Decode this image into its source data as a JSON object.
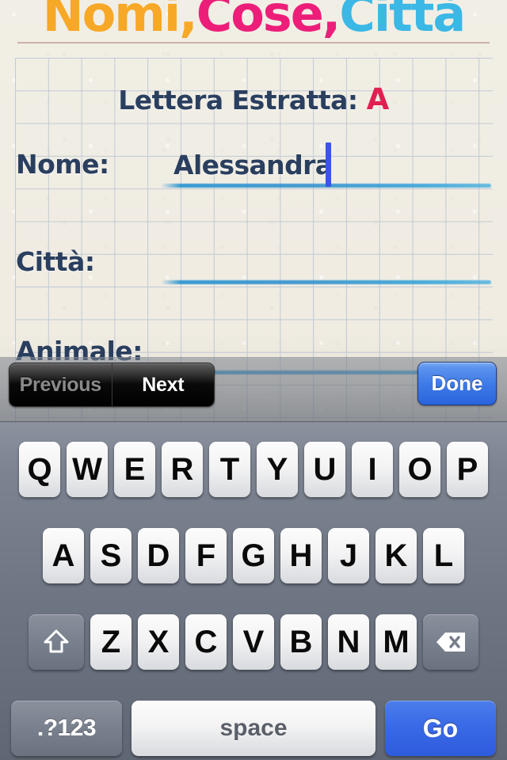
{
  "app": {
    "title_parts": [
      {
        "text": "Nomi,",
        "color": "#F7A827"
      },
      {
        "text": "Cose,",
        "color": "#EC1E79"
      },
      {
        "text": "Città",
        "color": "#3BB8E5"
      }
    ],
    "title_full": "Nomi, Cose, Città"
  },
  "form": {
    "drawn_letter_label": "Lettera Estratta:",
    "drawn_letter": "A",
    "drawn_letter_color": "#E02050",
    "fields": [
      {
        "label": "Nome:",
        "value": "Alessandra",
        "focused": true
      },
      {
        "label": "Città:",
        "value": "",
        "focused": false
      },
      {
        "label": "Animale:",
        "value": "",
        "focused": false
      }
    ]
  },
  "toolbar": {
    "previous_label": "Previous",
    "previous_enabled": false,
    "next_label": "Next",
    "next_enabled": true,
    "done_label": "Done",
    "done_color": "#3E7AE8"
  },
  "keyboard": {
    "layout": "qwerty-uppercase",
    "row1": [
      "Q",
      "W",
      "E",
      "R",
      "T",
      "Y",
      "U",
      "I",
      "O",
      "P"
    ],
    "row2": [
      "A",
      "S",
      "D",
      "F",
      "G",
      "H",
      "J",
      "K",
      "L"
    ],
    "row3": [
      "Z",
      "X",
      "C",
      "V",
      "B",
      "N",
      "M"
    ],
    "shift_icon": "shift-arrow-icon",
    "backspace_icon": "backspace-icon",
    "numeric_label": ".?123",
    "space_label": "space",
    "return_label": "Go",
    "return_color": "#3A6AE6"
  }
}
